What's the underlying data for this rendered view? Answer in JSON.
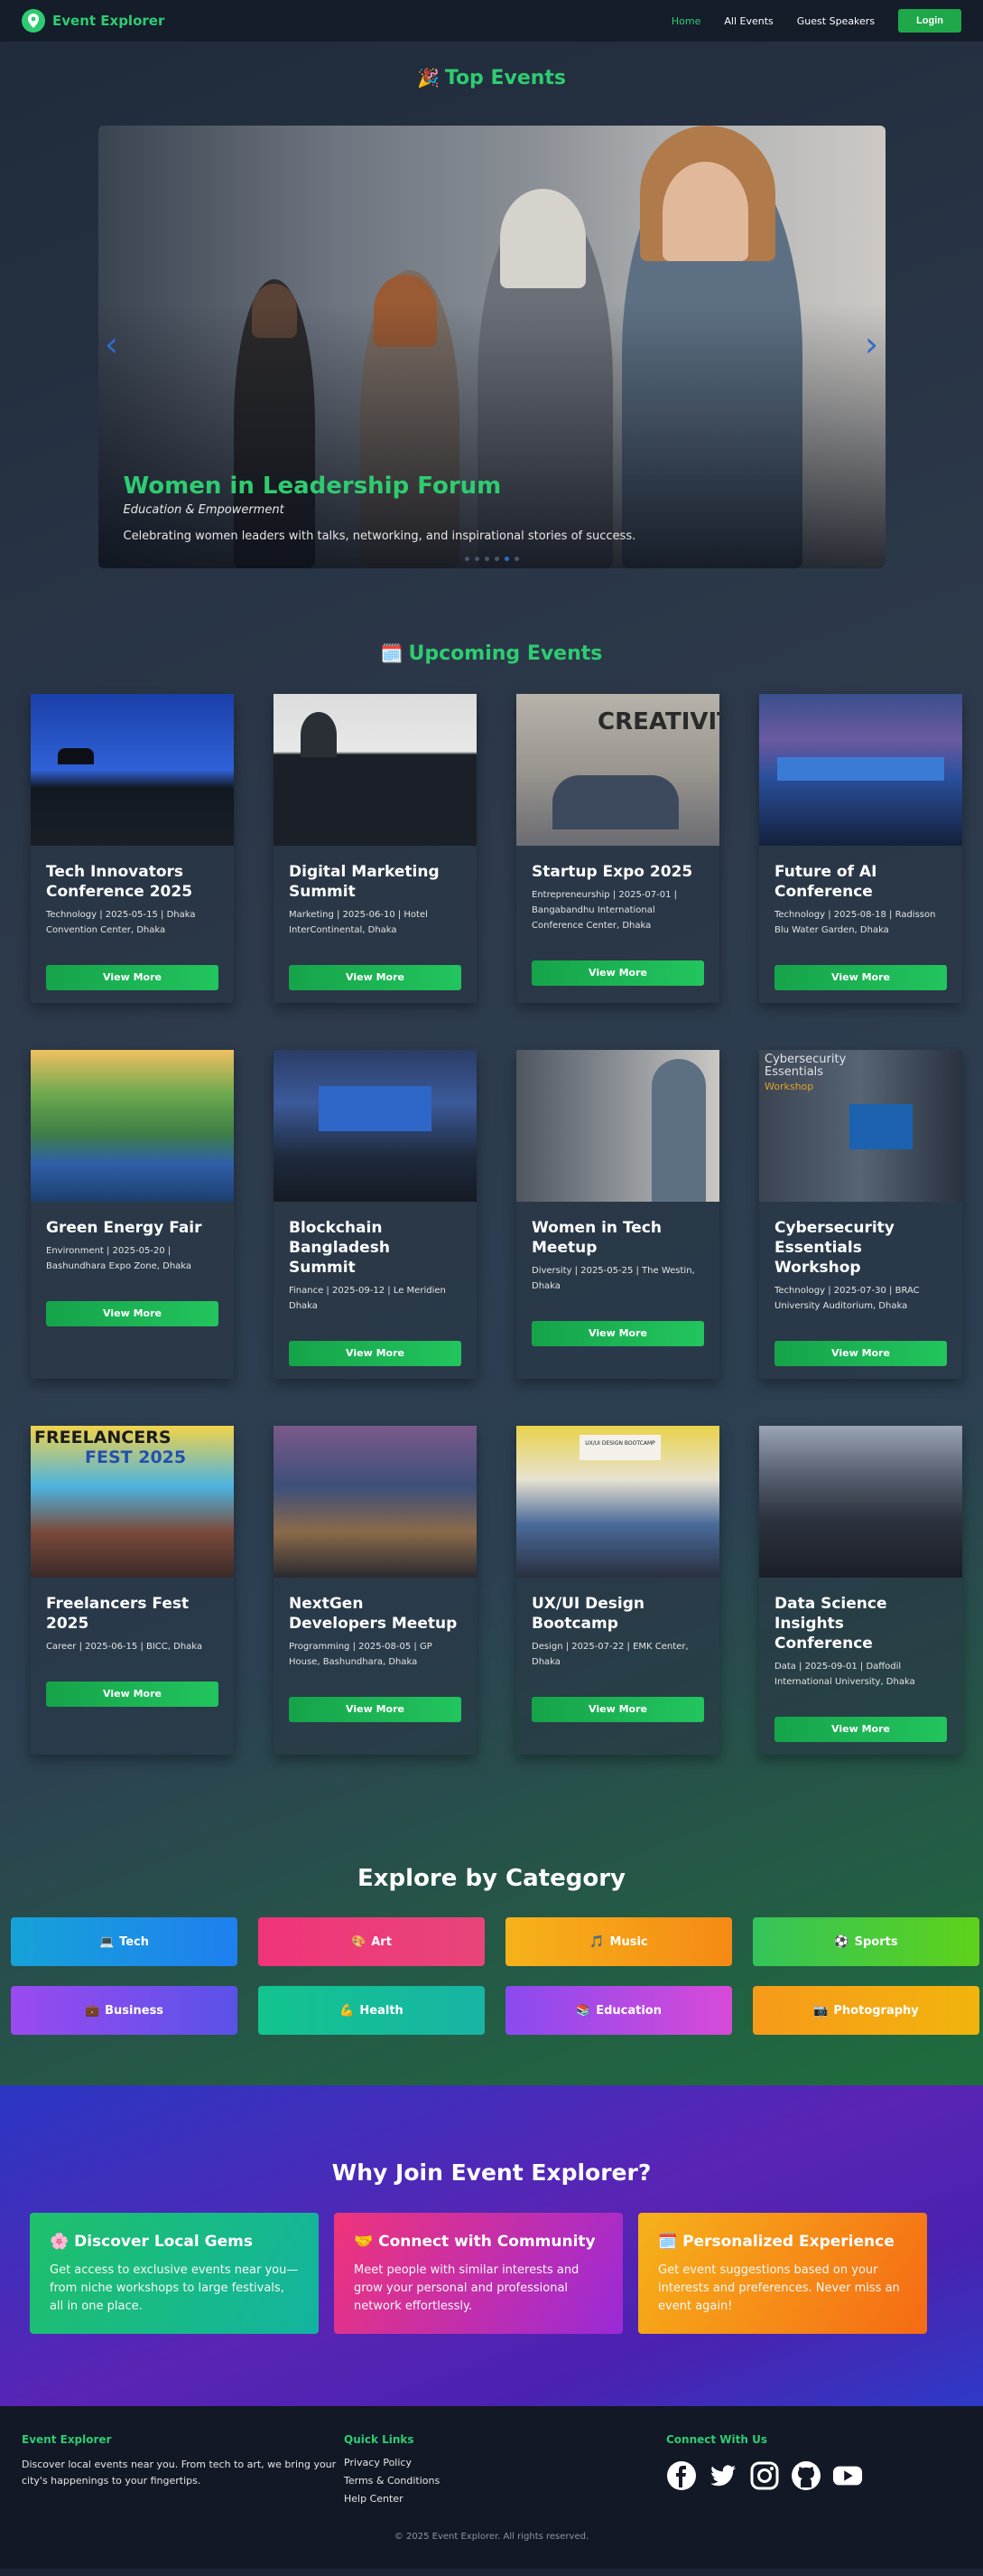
{
  "nav": {
    "brand": "Event Explorer",
    "links": [
      "Home",
      "All Events",
      "Guest Speakers"
    ],
    "login": "Login"
  },
  "hero": {
    "title_emoji": "🎉",
    "title": "Top Events",
    "slide_title": "Women in Leadership Forum",
    "slide_subtitle": "Education & Empowerment",
    "slide_desc": "Celebrating women leaders with talks, networking, and inspirational stories of success.",
    "prev": "‹",
    "next": "›"
  },
  "upcoming": {
    "title_emoji": "🗓️",
    "title": "Upcoming Events",
    "view_more": "View More",
    "events": [
      {
        "title": "Tech Innovators Conference 2025",
        "meta": "Technology | 2025-05-15 | Dhaka Convention Center, Dhaka"
      },
      {
        "title": "Digital Marketing Summit",
        "meta": "Marketing | 2025-06-10 | Hotel InterContinental, Dhaka"
      },
      {
        "title": "Startup Expo 2025",
        "meta": "Entrepreneurship | 2025-07-01 | Bangabandhu International Conference Center, Dhaka"
      },
      {
        "title": "Future of AI Conference",
        "meta": "Technology | 2025-08-18 | Radisson Blu Water Garden, Dhaka"
      },
      {
        "title": "Green Energy Fair",
        "meta": "Environment | 2025-05-20 | Bashundhara Expo Zone, Dhaka"
      },
      {
        "title": "Blockchain Bangladesh Summit",
        "meta": "Finance | 2025-09-12 | Le Meridien Dhaka"
      },
      {
        "title": "Women in Tech Meetup",
        "meta": "Diversity | 2025-05-25 | The Westin, Dhaka"
      },
      {
        "title": "Cybersecurity Essentials Workshop",
        "meta": "Technology | 2025-07-30 | BRAC University Auditorium, Dhaka"
      },
      {
        "title": "Freelancers Fest 2025",
        "meta": "Career | 2025-06-15 | BICC, Dhaka"
      },
      {
        "title": "NextGen Developers Meetup",
        "meta": "Programming | 2025-08-05 | GP House, Bashundhara, Dhaka"
      },
      {
        "title": "UX/UI Design Bootcamp",
        "meta": "Design | 2025-07-22 | EMK Center, Dhaka"
      },
      {
        "title": "Data Science Insights Conference",
        "meta": "Data | 2025-09-01 | Daffodil International University, Dhaka"
      }
    ],
    "image_text": {
      "creativity": "CREATIVITY",
      "cyber": "Cybersecurity Essentials",
      "workshop": "Workshop",
      "fest": "FREELANCERS",
      "fest2": "FEST 2025",
      "ux": "UX/UI DESIGN BOOTCAMP"
    }
  },
  "category": {
    "title": "Explore by Category",
    "items": [
      {
        "emoji": "💻",
        "label": "Tech"
      },
      {
        "emoji": "🎨",
        "label": "Art"
      },
      {
        "emoji": "🎵",
        "label": "Music"
      },
      {
        "emoji": "⚽",
        "label": "Sports"
      },
      {
        "emoji": "💼",
        "label": "Business"
      },
      {
        "emoji": "💪",
        "label": "Health"
      },
      {
        "emoji": "📚",
        "label": "Education"
      },
      {
        "emoji": "📷",
        "label": "Photography"
      }
    ]
  },
  "why": {
    "title": "Why Join Event Explorer?",
    "cards": [
      {
        "emoji": "🌸",
        "title": "Discover Local Gems",
        "text": "Get access to exclusive events near you—from niche workshops to large festivals, all in one place."
      },
      {
        "emoji": "🤝",
        "title": "Connect with Community",
        "text": "Meet people with similar interests and grow your personal and professional network effortlessly."
      },
      {
        "emoji": "🗓️",
        "title": "Personalized Experience",
        "text": "Get event suggestions based on your interests and preferences. Never miss an event again!"
      }
    ]
  },
  "footer": {
    "about_title": "Event Explorer",
    "about_text": "Discover local events near you. From tech to art, we bring your city's happenings to your fingertips.",
    "links_title": "Quick Links",
    "links": [
      "Privacy Policy",
      "Terms & Conditions",
      "Help Center"
    ],
    "connect_title": "Connect With Us",
    "social": [
      "facebook-icon",
      "twitter-icon",
      "instagram-icon",
      "github-icon",
      "youtube-icon"
    ],
    "copyright": "© 2025 Event Explorer. All rights reserved."
  },
  "colors": {
    "accent": "#2ecc71",
    "button_green": "#1fa84a",
    "nav_bg": "#151d2a"
  }
}
